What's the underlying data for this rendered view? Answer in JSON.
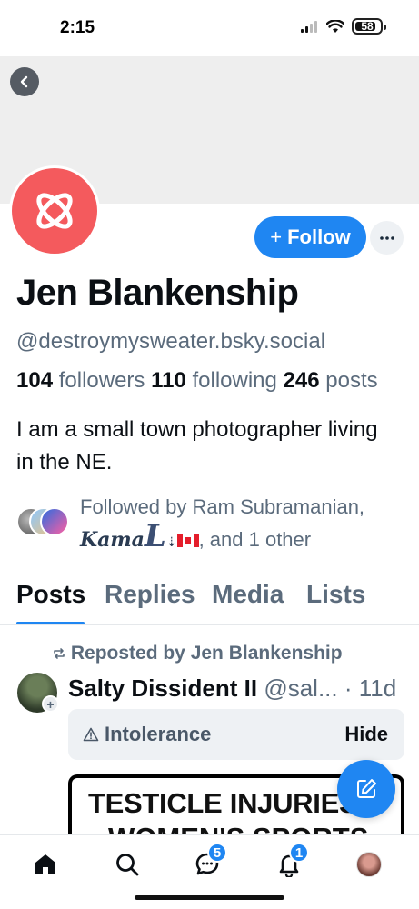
{
  "status_bar": {
    "time": "2:15",
    "battery": "58"
  },
  "profile": {
    "display_name": "Jen Blankenship",
    "handle": "@destroymysweater.bsky.social",
    "followers_count": "104",
    "followers_label": "followers",
    "following_count": "110",
    "following_label": "following",
    "posts_count": "246",
    "posts_label": "posts",
    "bio": "I am a small town photographer living in the NE.",
    "follow_button": "Follow",
    "followed_by_prefix": "Followed by Ram Subramanian,",
    "followed_by_kamal": "Kama",
    "followed_by_kamal_letter": "L",
    "followed_by_suffix": ", and 1 other"
  },
  "tabs": [
    "Posts",
    "Replies",
    "Media",
    "Lists"
  ],
  "post": {
    "repost_text": "Reposted by Jen Blankenship",
    "author_name": "Salty Dissident II",
    "author_handle": "@sal...",
    "time": "· 11d",
    "content_warning": "Intolerance",
    "hide_label": "Hide",
    "image_text_line1": "TESTICLE INJURIES",
    "image_text_line2": "WOMEN'S SPORTS"
  },
  "bottom_nav": {
    "chat_badge": "5",
    "notifications_badge": "1"
  },
  "colors": {
    "accent": "#1f86f2",
    "avatar_bg": "#f45a5d",
    "muted_text": "#5b6b7c",
    "banner": "#eeeeee"
  },
  "icons": [
    "back-icon",
    "ellipsis-icon",
    "repost-icon",
    "warning-icon",
    "compose-icon",
    "home-icon",
    "search-icon",
    "chat-icon",
    "bell-icon"
  ]
}
